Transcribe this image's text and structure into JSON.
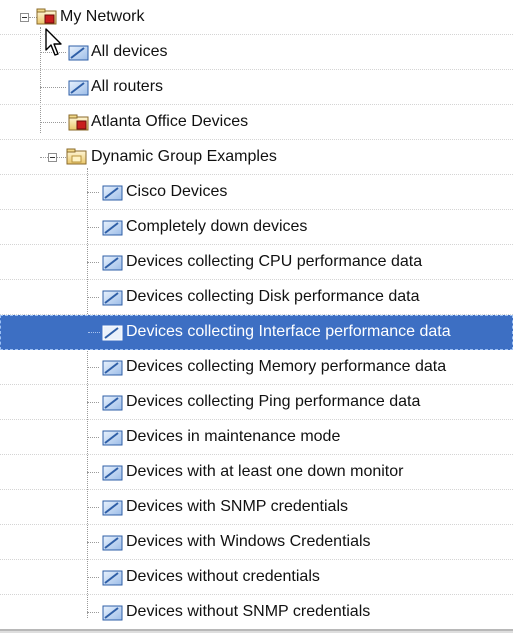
{
  "tree": {
    "root": {
      "label": "My Network",
      "icon": "network-folder-icon"
    },
    "items": [
      {
        "label": "All devices",
        "icon": "group-icon"
      },
      {
        "label": "All routers",
        "icon": "group-icon"
      },
      {
        "label": "Atlanta Office Devices",
        "icon": "office-folder-icon"
      },
      {
        "label": "Dynamic Group Examples",
        "icon": "folder-icon"
      }
    ],
    "dynamic_groups": [
      {
        "label": "Cisco Devices"
      },
      {
        "label": "Completely down devices"
      },
      {
        "label": "Devices collecting CPU performance data"
      },
      {
        "label": "Devices collecting Disk performance data"
      },
      {
        "label": "Devices collecting Interface performance data",
        "selected": true
      },
      {
        "label": "Devices collecting Memory performance data"
      },
      {
        "label": "Devices collecting Ping performance data"
      },
      {
        "label": "Devices in maintenance mode"
      },
      {
        "label": "Devices with at least one down monitor"
      },
      {
        "label": "Devices with SNMP credentials"
      },
      {
        "label": "Devices with Windows Credentials"
      },
      {
        "label": "Devices without credentials"
      },
      {
        "label": "Devices without SNMP credentials"
      }
    ]
  },
  "colors": {
    "selection": "#3d6fc3",
    "selection_text": "#ffffff",
    "text": "#111111"
  }
}
